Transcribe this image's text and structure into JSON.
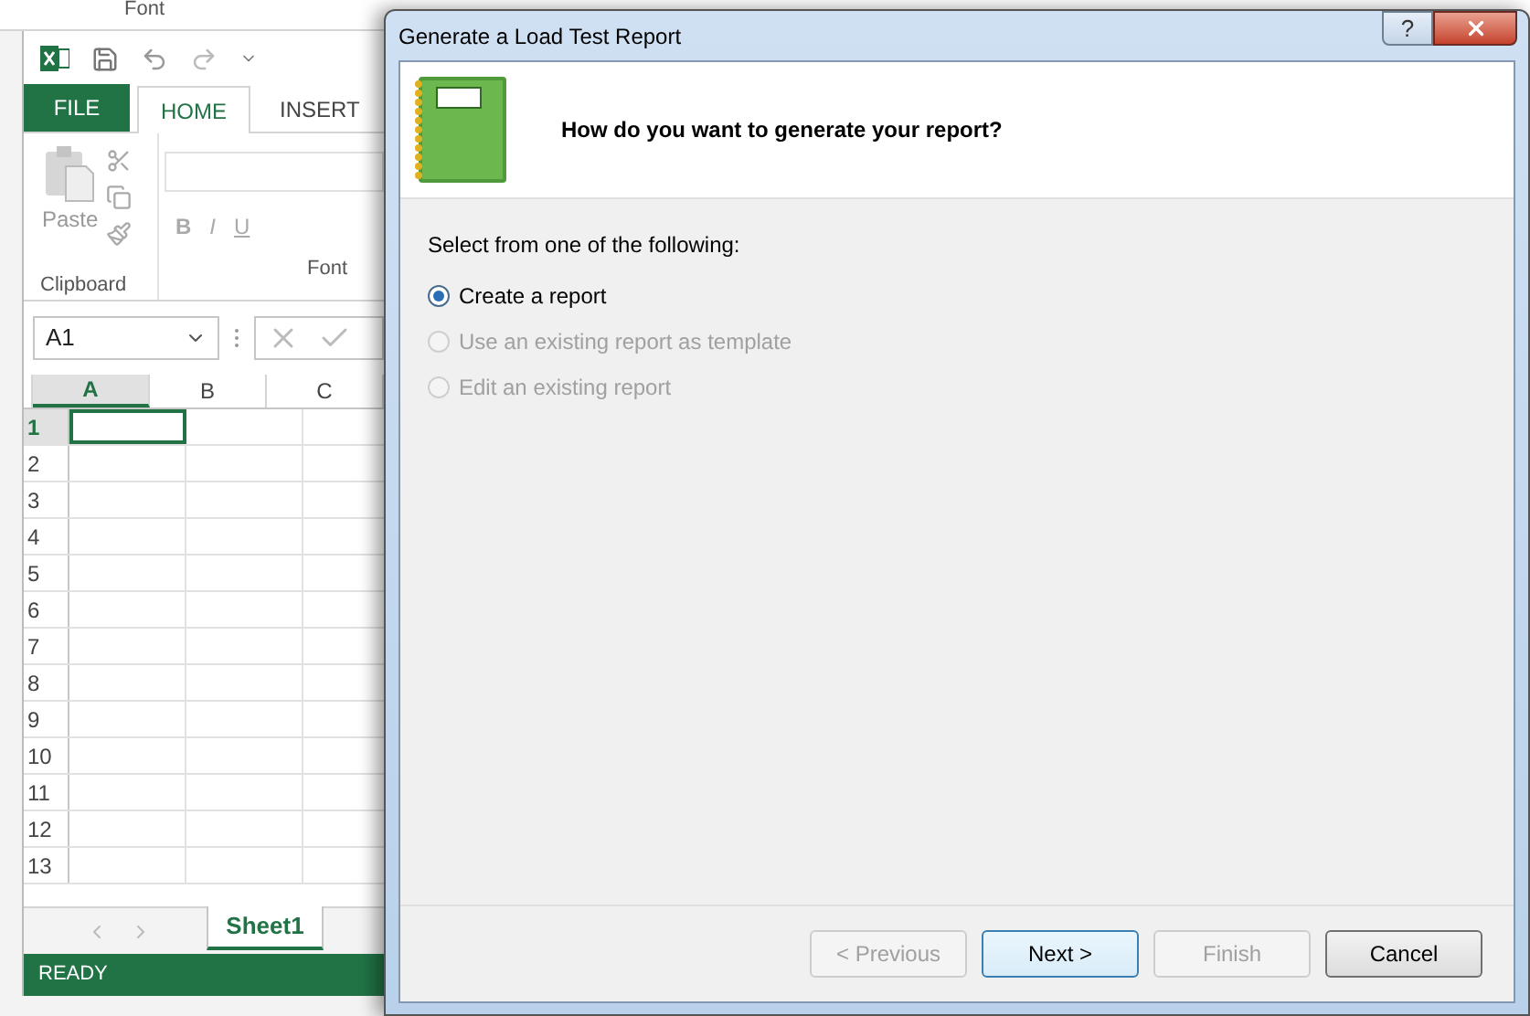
{
  "background_ribbon": {
    "group_label": "Font"
  },
  "excel": {
    "tabs": [
      {
        "label": "FILE",
        "kind": "file",
        "selected": false
      },
      {
        "label": "HOME",
        "kind": "tab",
        "selected": true
      },
      {
        "label": "INSERT",
        "kind": "tab",
        "selected": false
      }
    ],
    "clipboard": {
      "paste_label": "Paste",
      "group_label": "Clipboard"
    },
    "font_group": {
      "bold": "B",
      "italic": "I",
      "underline": "U",
      "group_label": "Font"
    },
    "name_box": "A1",
    "columns": [
      {
        "label": "A",
        "selected": true
      },
      {
        "label": "B",
        "selected": false
      },
      {
        "label": "C",
        "selected": false
      }
    ],
    "rows": [
      {
        "label": "1",
        "selected": true
      },
      {
        "label": "2",
        "selected": false
      },
      {
        "label": "3",
        "selected": false
      },
      {
        "label": "4",
        "selected": false
      },
      {
        "label": "5",
        "selected": false
      },
      {
        "label": "6",
        "selected": false
      },
      {
        "label": "7",
        "selected": false
      },
      {
        "label": "8",
        "selected": false
      },
      {
        "label": "9",
        "selected": false
      },
      {
        "label": "10",
        "selected": false
      },
      {
        "label": "11",
        "selected": false
      },
      {
        "label": "12",
        "selected": false
      },
      {
        "label": "13",
        "selected": false
      }
    ],
    "sheet_tabs": [
      {
        "label": "Sheet1",
        "selected": true
      }
    ],
    "status": "READY"
  },
  "dialog": {
    "title": "Generate a Load Test Report",
    "help_glyph": "?",
    "heading": "How do you want to generate your report?",
    "prompt": "Select from one of the following:",
    "options": [
      {
        "label": "Create a report",
        "selected": true,
        "disabled": false
      },
      {
        "label": "Use an existing report as template",
        "selected": false,
        "disabled": true
      },
      {
        "label": "Edit an existing report",
        "selected": false,
        "disabled": true
      }
    ],
    "buttons": [
      {
        "label": "< Previous",
        "disabled": true,
        "default": false
      },
      {
        "label": "Next >",
        "disabled": false,
        "default": true
      },
      {
        "label": "Finish",
        "disabled": true,
        "default": false
      },
      {
        "label": "Cancel",
        "disabled": false,
        "default": false
      }
    ]
  }
}
